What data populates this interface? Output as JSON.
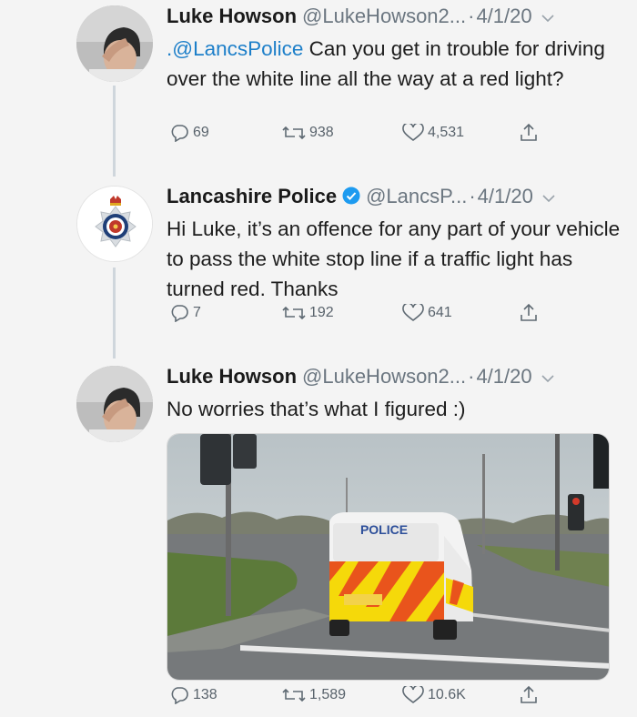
{
  "tweets": [
    {
      "name": "Luke Howson",
      "handle": "@LukeHowson2...",
      "date": "4/1/20",
      "mention": ".@LancsPolice",
      "text": " Can you get in trouble for driving over the white line all the way at a red light?",
      "replies": "69",
      "retweets": "938",
      "likes": "4,531"
    },
    {
      "name": "Lancashire Police",
      "handle": "@LancsP...",
      "date": "4/1/20",
      "text": "Hi Luke, it’s an offence for any part of your vehicle to pass the white stop line if a traffic light has turned red. Thanks",
      "replies": "7",
      "retweets": "192",
      "likes": "641"
    },
    {
      "name": "Luke Howson",
      "handle": "@LukeHowson2...",
      "date": "4/1/20",
      "text": "No worries that’s what I figured :)",
      "replies": "138",
      "retweets": "1,589",
      "likes": "10.6K",
      "photo_van_label": "POLICE"
    }
  ],
  "separator": "·",
  "colors": {
    "link": "#1d7fc9",
    "verified": "#1d9bf0",
    "meta": "#6b7680"
  },
  "icons": [
    "reply-icon",
    "retweet-icon",
    "like-icon",
    "share-icon",
    "chevron-down-icon",
    "verified-badge-icon"
  ]
}
